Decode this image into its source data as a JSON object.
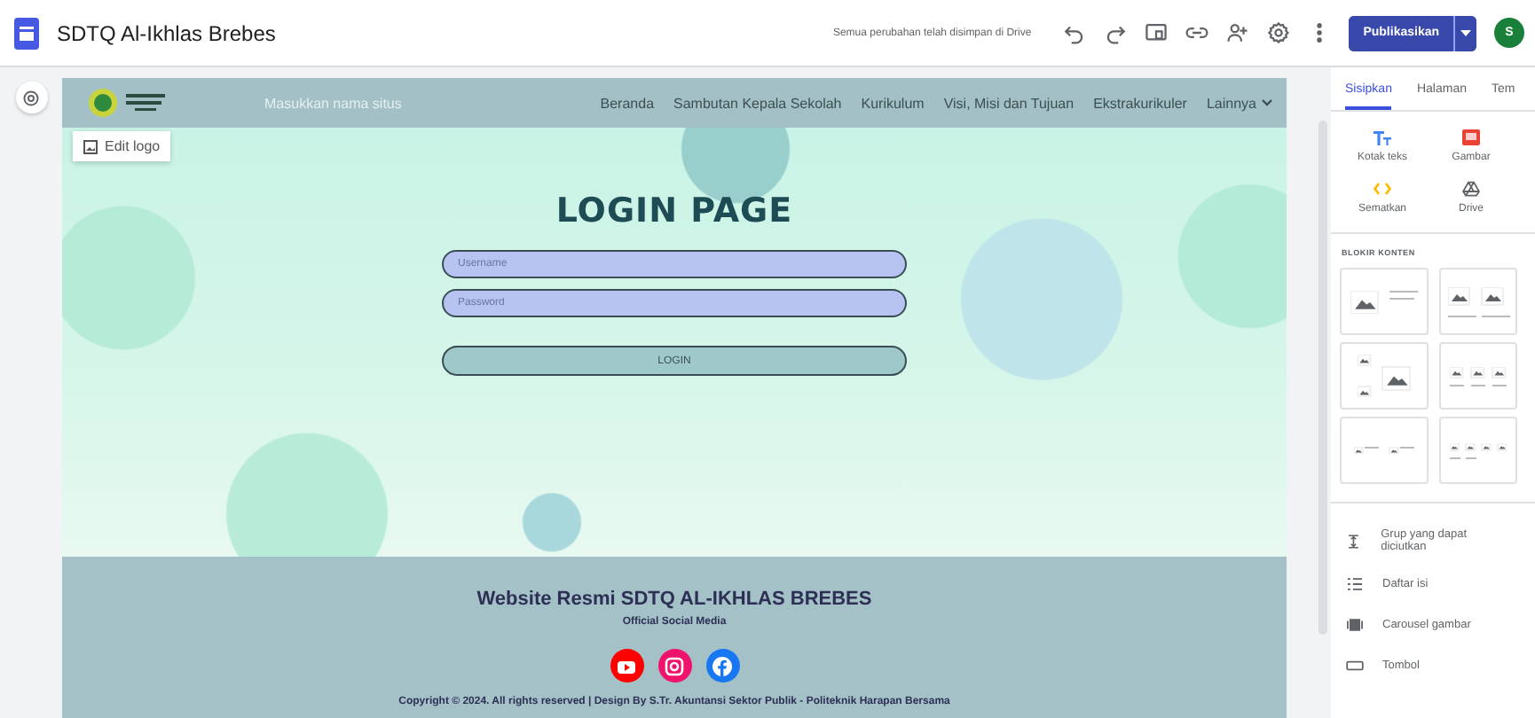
{
  "topbar": {
    "title": "SDTQ Al-Ikhlas Brebes",
    "save_status": "Semua perubahan telah disimpan di Drive",
    "publish_button": "Publikasikan",
    "avatar": "S"
  },
  "site_header": {
    "site_name_placeholder": "Masukkan nama situs",
    "edit_logo": "Edit logo",
    "nav": [
      {
        "label": "Beranda",
        "dropdown": false
      },
      {
        "label": "Sambutan Kepala Sekolah",
        "dropdown": false
      },
      {
        "label": "Kurikulum",
        "dropdown": false
      },
      {
        "label": "Visi, Misi dan Tujuan",
        "dropdown": false
      },
      {
        "label": "Ekstrakurikuler",
        "dropdown": false
      },
      {
        "label": "Lainnya",
        "dropdown": true
      }
    ]
  },
  "login": {
    "title": "LOGIN PAGE",
    "username_placeholder": "Username",
    "password_placeholder": "Password",
    "button": "LOGIN"
  },
  "footer": {
    "title": "Website Resmi SDTQ AL-IKHLAS BREBES",
    "subtitle": "Official Social Media",
    "social": [
      {
        "kind": "youtube",
        "color": "#ff0000"
      },
      {
        "kind": "instagram",
        "color": "#f0136b"
      },
      {
        "kind": "facebook",
        "color": "#1877f2"
      }
    ],
    "copyright": "Copyright © 2024. All rights reserved | Design By S.Tr. Akuntansi Sektor Publik - Politeknik Harapan Bersama"
  },
  "panel": {
    "tabs": [
      {
        "label": "Sisipkan",
        "selected": true
      },
      {
        "label": "Halaman",
        "selected": false
      },
      {
        "label": "Tem",
        "selected": false
      }
    ],
    "insert_items": [
      {
        "kind": "text",
        "label": "Kotak teks"
      },
      {
        "kind": "image",
        "label": "Gambar"
      },
      {
        "kind": "embed",
        "label": "Sematkan"
      },
      {
        "kind": "drive",
        "label": "Drive"
      }
    ],
    "content_blocks_heading": "BLOKIR KONTEN",
    "components": [
      {
        "kind": "collapsible",
        "label": "Grup yang dapat diciutkan"
      },
      {
        "kind": "toc",
        "label": "Daftar isi"
      },
      {
        "kind": "carousel",
        "label": "Carousel gambar"
      },
      {
        "kind": "button",
        "label": "Tombol"
      }
    ]
  }
}
